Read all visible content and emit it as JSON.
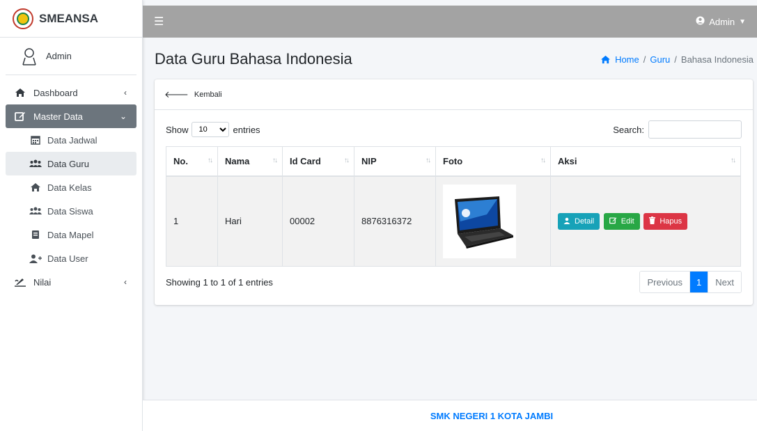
{
  "brand": {
    "name": "SMEANSA"
  },
  "user": {
    "name": "Admin"
  },
  "sidebar": {
    "items": [
      {
        "label": "Dashboard"
      },
      {
        "label": "Master Data"
      },
      {
        "label": "Nilai"
      }
    ],
    "sub_items": [
      {
        "label": "Data Jadwal"
      },
      {
        "label": "Data Guru"
      },
      {
        "label": "Data Kelas"
      },
      {
        "label": "Data Siswa"
      },
      {
        "label": "Data Mapel"
      },
      {
        "label": "Data User"
      }
    ]
  },
  "topbar": {
    "user_menu": "Admin"
  },
  "page": {
    "title": "Data Guru Bahasa Indonesia",
    "breadcrumb": [
      "Home",
      "Guru",
      "Bahasa Indonesia"
    ]
  },
  "card": {
    "back_label": "Kembali"
  },
  "datatable": {
    "show_label": "Show",
    "entries_label": "entries",
    "page_length": "10",
    "search_label": "Search:",
    "search_value": "",
    "columns": [
      "No.",
      "Nama",
      "Id Card",
      "NIP",
      "Foto",
      "Aksi"
    ],
    "rows": [
      {
        "no": "1",
        "nama": "Hari",
        "id_card": "00002",
        "nip": "8876316372",
        "foto": "laptop"
      }
    ],
    "actions": {
      "detail": "Detail",
      "edit": "Edit",
      "hapus": "Hapus"
    },
    "info": "Showing 1 to 1 of 1 entries",
    "pagination": {
      "previous": "Previous",
      "current": "1",
      "next": "Next"
    }
  },
  "footer": {
    "text": "SMK NEGERI 1 KOTA JAMBI"
  },
  "colors": {
    "accent": "#007bff",
    "sidebar_active": "#6c757d",
    "topbar": "#a3a3a3",
    "info": "#17a2b8",
    "success": "#28a745",
    "danger": "#dc3545"
  }
}
